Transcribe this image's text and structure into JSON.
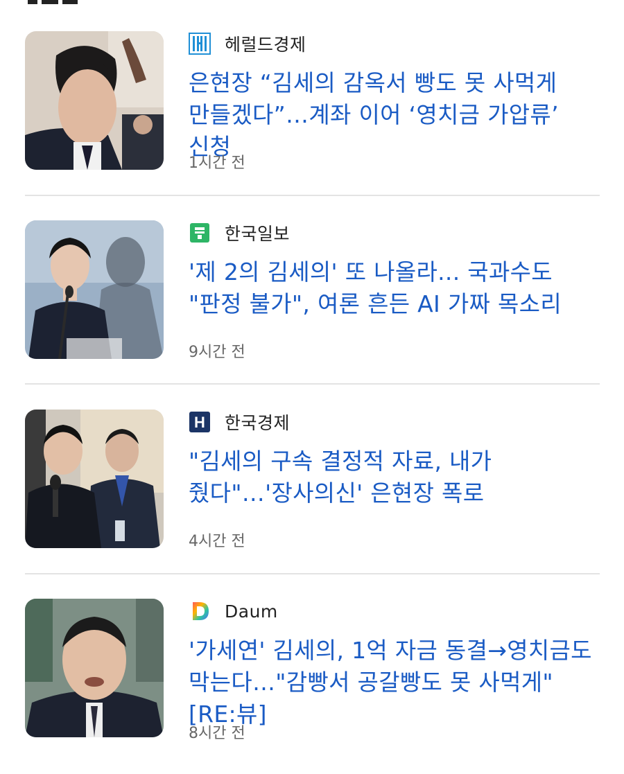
{
  "news": [
    {
      "source": "헤럴드경제",
      "headline": "은현장 “김세의 감옥서 빵도 못 사먹게 만들겠다”…계좌 이어 ‘영치금 가압류’ 신청",
      "time": "1시간 전",
      "logo_icon": "herald-logo-icon",
      "logo_color": "#1f8fd6"
    },
    {
      "source": "한국일보",
      "headline": "'제 2의 김세의' 또 나올라... 국과수도 \"판정 불가\", 여론 흔든 AI 가짜 목소리",
      "time": "9시간 전",
      "logo_icon": "hankook-ilbo-logo-icon",
      "logo_color": "#2eb566"
    },
    {
      "source": "한국경제",
      "headline": "\"김세의 구속 결정적 자료, 내가 줬다\"…'장사의신' 은현장 폭로",
      "time": "4시간 전",
      "logo_icon": "hankyung-logo-icon",
      "logo_color": "#1b3466",
      "logo_letter": "H"
    },
    {
      "source": "Daum",
      "headline": "'가세연' 김세의, 1억 자금 동결→영치금도 막는다…\"감빵서 공갈빵도 못 사먹게\" [RE:뷰]",
      "time": "8시간 전",
      "logo_icon": "daum-logo-icon",
      "logo_color": "#4a6cf7",
      "logo_letter": "D"
    }
  ],
  "colors": {
    "headline": "#1a5bc4",
    "source": "#222222",
    "time": "#666666",
    "divider": "#e3e3e3"
  }
}
